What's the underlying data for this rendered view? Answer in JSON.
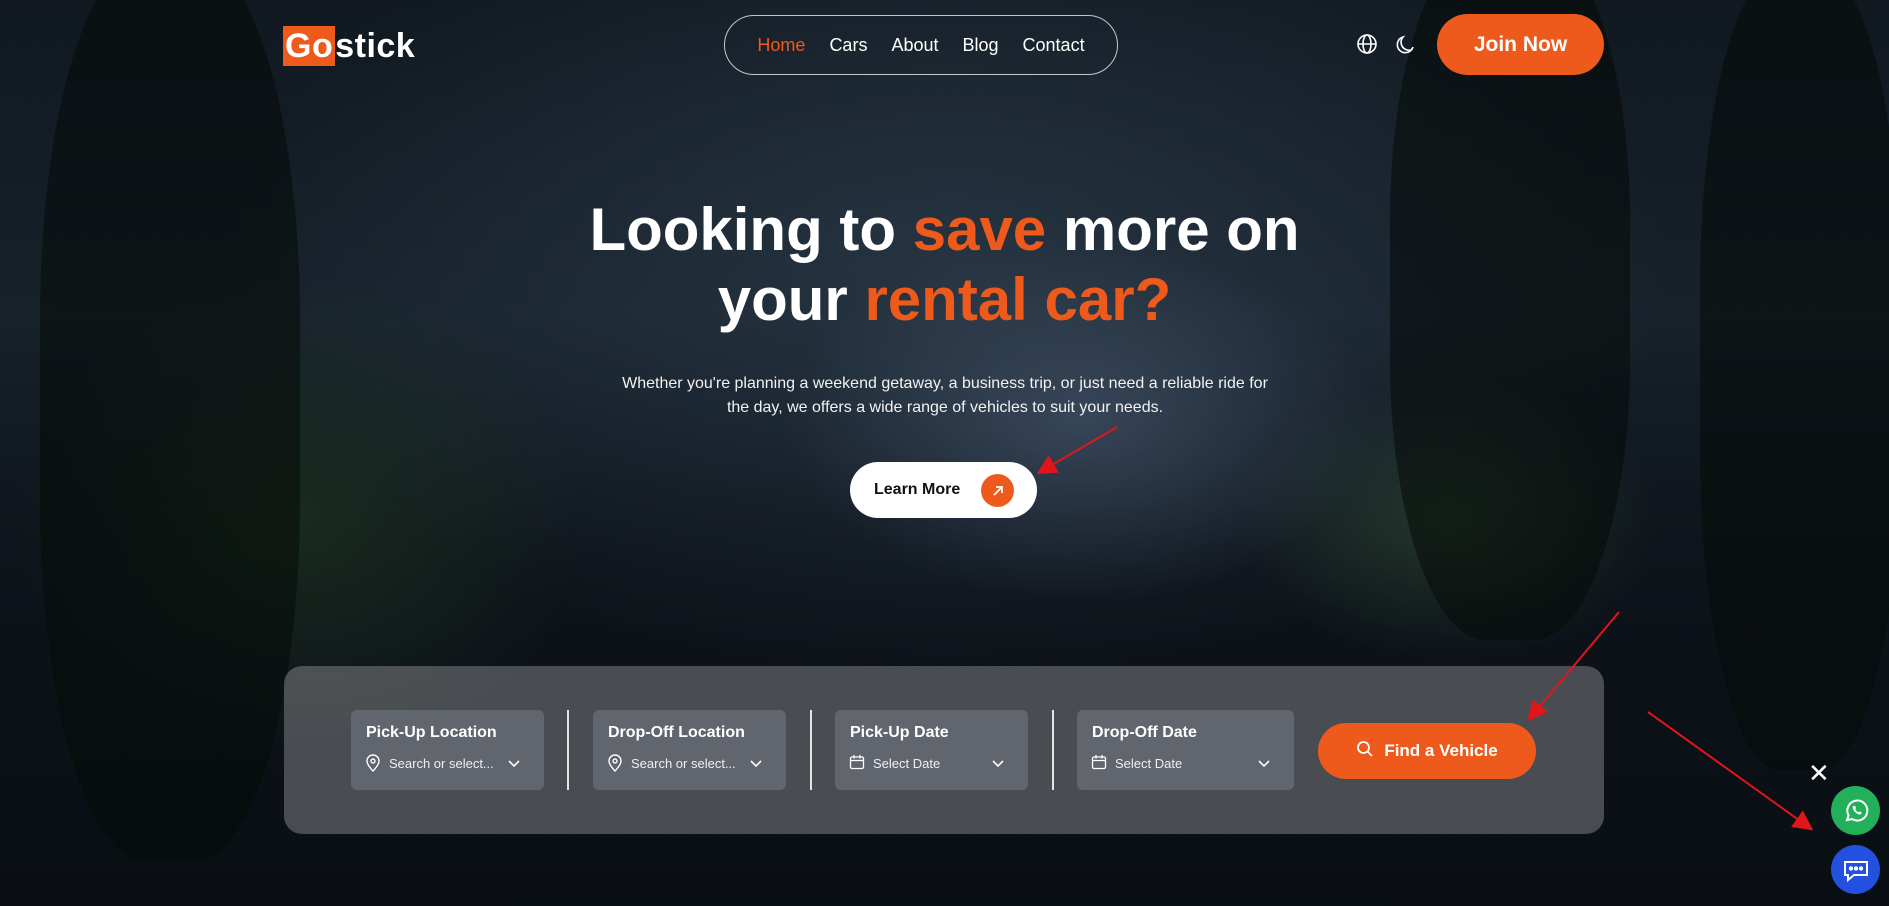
{
  "logo": {
    "prefix": "Go",
    "suffix": "stick"
  },
  "nav": {
    "items": [
      "Home",
      "Cars",
      "About",
      "Blog",
      "Contact"
    ],
    "active": "Home"
  },
  "header": {
    "language_icon": "globe-icon",
    "theme_icon": "moon-icon",
    "join_label": "Join Now"
  },
  "hero": {
    "title_1": "Looking to ",
    "title_accent_1": "save",
    "title_2": " more on",
    "title_3": "your ",
    "title_accent_2": "rental car?",
    "subtitle": "Whether you're planning a weekend getaway, a business trip, or just need a reliable ride for the day, we offers a wide range of vehicles to suit your needs.",
    "cta_label": "Learn More"
  },
  "search": {
    "fields": [
      {
        "label": "Pick-Up Location",
        "value": "Search or select...",
        "icon": "location-pin-icon"
      },
      {
        "label": "Drop-Off Location",
        "value": "Search or select...",
        "icon": "location-pin-icon"
      },
      {
        "label": "Pick-Up Date",
        "value": "Select Date",
        "icon": "calendar-icon"
      },
      {
        "label": "Drop-Off Date",
        "value": "Select Date",
        "icon": "calendar-icon"
      }
    ],
    "button_label": "Find a Vehicle"
  },
  "floating": {
    "close_label": "✕",
    "whatsapp_icon": "whatsapp-icon",
    "chat_icon": "chat-icon"
  },
  "colors": {
    "accent": "#ee5a1c",
    "whatsapp": "#22b05a",
    "chat": "#2450e0"
  }
}
